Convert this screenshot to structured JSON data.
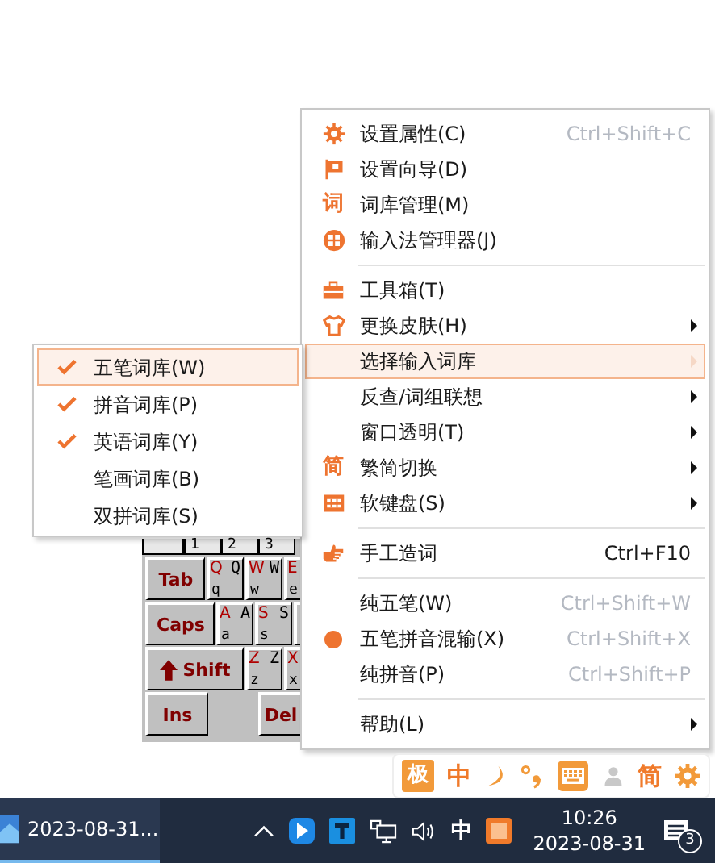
{
  "main_menu": {
    "items": [
      {
        "kind": "gear",
        "label": "设置属性(C)",
        "shortcut": "Ctrl+Shift+C",
        "shortcut_dim": true,
        "submenu": false,
        "selected": false
      },
      {
        "kind": "flag",
        "label": "设置向导(D)",
        "submenu": false,
        "selected": false
      },
      {
        "kind": "glyph",
        "glyph": "词",
        "label": "词库管理(M)",
        "submenu": false,
        "selected": false
      },
      {
        "kind": "grid",
        "label": "输入法管理器(J)",
        "submenu": false,
        "selected": false
      },
      {
        "kind": "separator"
      },
      {
        "kind": "toolbox",
        "label": "工具箱(T)",
        "submenu": false,
        "selected": false
      },
      {
        "kind": "shirt",
        "label": "更换皮肤(H)",
        "submenu": true,
        "selected": false
      },
      {
        "kind": "plain",
        "label": "选择输入词库",
        "submenu": true,
        "selected": true
      },
      {
        "kind": "plain",
        "label": "反查/词组联想",
        "submenu": true,
        "selected": false
      },
      {
        "kind": "plain",
        "label": "窗口透明(T)",
        "submenu": true,
        "selected": false
      },
      {
        "kind": "glyph",
        "glyph": "简",
        "label": "繁简切换",
        "submenu": true,
        "selected": false
      },
      {
        "kind": "keyboard",
        "label": "软键盘(S)",
        "submenu": true,
        "selected": false
      },
      {
        "kind": "separator"
      },
      {
        "kind": "hand",
        "label": "手工造词",
        "shortcut": "Ctrl+F10",
        "shortcut_dim": false,
        "submenu": false,
        "selected": false
      },
      {
        "kind": "separator"
      },
      {
        "kind": "plain",
        "label": "纯五笔(W)",
        "shortcut": "Ctrl+Shift+W",
        "shortcut_dim": true,
        "submenu": false,
        "selected": false
      },
      {
        "kind": "radio",
        "label": "五笔拼音混输(X)",
        "shortcut": "Ctrl+Shift+X",
        "shortcut_dim": true,
        "submenu": false,
        "selected": false
      },
      {
        "kind": "plain",
        "label": "纯拼音(P)",
        "shortcut": "Ctrl+Shift+P",
        "shortcut_dim": true,
        "submenu": false,
        "selected": false
      },
      {
        "kind": "separator"
      },
      {
        "kind": "plain",
        "label": "帮助(L)",
        "submenu": true,
        "selected": false
      }
    ]
  },
  "submenu": {
    "items": [
      {
        "label": "五笔词库(W)",
        "checked": true,
        "selected": true
      },
      {
        "label": "拼音词库(P)",
        "checked": true,
        "selected": false
      },
      {
        "label": "英语词库(Y)",
        "checked": true,
        "selected": false
      },
      {
        "label": "笔画词库(B)",
        "checked": false,
        "selected": false
      },
      {
        "label": "双拼词库(S)",
        "checked": false,
        "selected": false
      }
    ]
  },
  "soft_keyboard": {
    "number_keys": [
      "1",
      "2",
      "3"
    ],
    "key_rows": [
      {
        "keys": [
          {
            "kind": "func",
            "label": "Tab"
          },
          {
            "kind": "char",
            "upper": "Q",
            "alt": "Q",
            "lower": "q"
          },
          {
            "kind": "char",
            "upper": "W",
            "alt": "W",
            "lower": "w"
          },
          {
            "kind": "char",
            "upper": "E",
            "lower": "e"
          }
        ]
      },
      {
        "keys": [
          {
            "kind": "func",
            "label": "Caps"
          },
          {
            "kind": "char",
            "upper": "A",
            "alt": "A",
            "lower": "a"
          },
          {
            "kind": "char",
            "upper": "S",
            "alt": "S",
            "lower": "s"
          },
          {
            "kind": "blank"
          }
        ]
      },
      {
        "keys": [
          {
            "kind": "shift",
            "label": "Shift"
          },
          {
            "kind": "char",
            "upper": "Z",
            "alt": "Z",
            "lower": "z"
          },
          {
            "kind": "char",
            "upper": "X",
            "lower": "x"
          }
        ]
      },
      {
        "keys": [
          {
            "kind": "func",
            "label": "Ins"
          },
          {
            "kind": "blank"
          },
          {
            "kind": "func",
            "label": "Del"
          }
        ]
      }
    ]
  },
  "ime_toolbar": {
    "items": [
      {
        "kind": "badge",
        "text": "极"
      },
      {
        "kind": "text",
        "text": "中"
      },
      {
        "kind": "moon"
      },
      {
        "kind": "punct"
      },
      {
        "kind": "keyboard"
      },
      {
        "kind": "person"
      },
      {
        "kind": "text",
        "text": "简"
      },
      {
        "kind": "gear"
      }
    ]
  },
  "taskbar": {
    "window_button": {
      "label": "2023-08-31...",
      "selected": true
    },
    "tray_ime": "中",
    "time": "10:26",
    "date": "2023-08-31",
    "notifications": "3"
  }
}
